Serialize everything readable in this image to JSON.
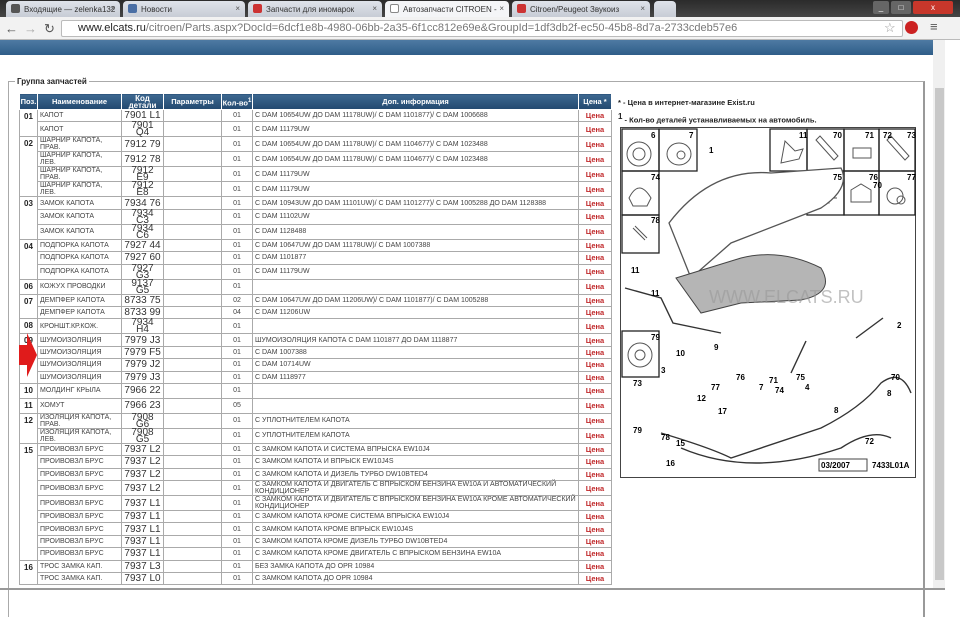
{
  "browser": {
    "tabs": [
      {
        "label": "Входящие — zelenka132",
        "active": false
      },
      {
        "label": "Новости",
        "active": false
      },
      {
        "label": "Запчасти для иномарок",
        "active": false
      },
      {
        "label": "Автозапчасти CITROEN -",
        "active": true
      },
      {
        "label": "Citroen/Peugeot Звукоиз",
        "active": false
      }
    ],
    "url_host": "www.elcats.ru",
    "url_path": "/citroen/Parts.aspx?DocId=6dcf1e8b-4980-06bb-2a35-6f1cc812e69e&GroupId=1df3db2f-ec50-45b8-8d7a-2733cdeb57e6"
  },
  "section_title": "Группа запчастей",
  "table": {
    "headers": {
      "pos": "Поз.",
      "name": "Наименование",
      "code": "Код детали",
      "params": "Параметры",
      "qty": "Кол-во",
      "qty_sup": "1",
      "info": "Доп. информация",
      "price": "Цена *"
    },
    "price_label": "Цена",
    "groups": [
      {
        "pos": "01",
        "items": [
          {
            "name": "КАПОТ",
            "code": "7901 L1",
            "qty": "01",
            "info": "С DAM 10654UW ДО DAM 11178UW)/ С DAM 1101877)/ С DAM 1006688"
          },
          {
            "name": "КАПОТ",
            "code": "7901 Q4",
            "qty": "01",
            "info": "С DAM 11179UW"
          }
        ]
      },
      {
        "pos": "02",
        "items": [
          {
            "name": "ШАРНИР КАПОТА, ПРАВ.",
            "code": "7912 79",
            "qty": "01",
            "info": "С DAM 10654UW ДО DAM 11178UW)/ С DAM 1104677)/ С DAM 1023488"
          },
          {
            "name": "ШАРНИР КАПОТА, ЛЕВ.",
            "code": "7912 78",
            "qty": "01",
            "info": "С DAM 10654UW ДО DAM 11178UW)/ С DAM 1104677)/ С DAM 1023488"
          },
          {
            "name": "ШАРНИР КАПОТА, ПРАВ.",
            "code": "7912 E9",
            "qty": "01",
            "info": "С DAM 11179UW"
          },
          {
            "name": "ШАРНИР КАПОТА, ЛЕВ.",
            "code": "7912 E8",
            "qty": "01",
            "info": "С DAM 11179UW"
          }
        ]
      },
      {
        "pos": "03",
        "items": [
          {
            "name": "ЗАМОК КАПОТА",
            "code": "7934 76",
            "qty": "01",
            "info": "С DAM 10943UW ДО DAM 11101UW)/ С DAM 1101277)/ С DAM 1005288 ДО DAM 1128388"
          },
          {
            "name": "ЗАМОК КАПОТА",
            "code": "7934 C3",
            "qty": "01",
            "info": "С DAM 11102UW"
          },
          {
            "name": "ЗАМОК КАПОТА",
            "code": "7934 C6",
            "qty": "01",
            "info": "С DAM 1128488"
          }
        ]
      },
      {
        "pos": "04",
        "items": [
          {
            "name": "ПОДПОРКА КАПОТА",
            "code": "7927 44",
            "qty": "01",
            "info": "С DAM 10647UW ДО DAM 11178UW)/ С DAM 1007388"
          },
          {
            "name": "ПОДПОРКА КАПОТА",
            "code": "7927 60",
            "qty": "01",
            "info": "С DAM 1101877"
          },
          {
            "name": "ПОДПОРКА КАПОТА",
            "code": "7927 G3",
            "qty": "01",
            "info": "С DAM 11179UW"
          }
        ]
      },
      {
        "pos": "06",
        "items": [
          {
            "name": "КОЖУХ ПРОВОДКИ",
            "code": "9137 G5",
            "qty": "01",
            "info": ""
          }
        ]
      },
      {
        "pos": "07",
        "items": [
          {
            "name": "ДЕМПФЕР КАПОТА",
            "code": "8733 75",
            "qty": "02",
            "info": "С DAM 10647UW ДО DAM 11206UW)/ С DAM 1101877)/ С DAM 1005288"
          },
          {
            "name": "ДЕМПФЕР КАПОТА",
            "code": "8733 99",
            "qty": "04",
            "info": "С DAM 11206UW"
          }
        ]
      },
      {
        "pos": "08",
        "items": [
          {
            "name": "КРОНШТ.КР.КОЖ.",
            "code": "7934 H4",
            "qty": "01",
            "info": ""
          }
        ]
      },
      {
        "pos": "09",
        "items": [
          {
            "name": "ШУМОИЗОЛЯЦИЯ",
            "code": "7979 J3",
            "qty": "01",
            "info": "ШУМОИЗОЛЯЦИЯ КАПОТА С DAM 1101877 ДО DAM 1118877"
          },
          {
            "name": "ШУМОИЗОЛЯЦИЯ",
            "code": "7979 F5",
            "qty": "01",
            "info": "С DAM 1007388"
          },
          {
            "name": "ШУМОИЗОЛЯЦИЯ",
            "code": "7979 J2",
            "qty": "01",
            "info": "С DAM 10714UW"
          },
          {
            "name": "ШУМОИЗОЛЯЦИЯ",
            "code": "7979 J3",
            "qty": "01",
            "info": "С DAM 1118977"
          }
        ]
      },
      {
        "pos": "10",
        "items": [
          {
            "name": "МОЛДИНГ КРЫЛА",
            "code": "7966 22",
            "qty": "01",
            "info": ""
          }
        ]
      },
      {
        "pos": "11",
        "items": [
          {
            "name": "ХОМУТ",
            "code": "7966 23",
            "qty": "05",
            "info": ""
          }
        ]
      },
      {
        "pos": "12",
        "items": [
          {
            "name": "ИЗОЛЯЦИЯ КАПОТА, ПРАВ.",
            "code": "7908 G6",
            "qty": "01",
            "info": "С УПЛОТНИТЕЛЕМ КАПОТА"
          },
          {
            "name": "ИЗОЛЯЦИЯ КАПОТА, ЛЕВ.",
            "code": "7908 G5",
            "qty": "01",
            "info": "С УПЛОТНИТЕЛЕМ КАПОТА"
          }
        ]
      },
      {
        "pos": "15",
        "items": [
          {
            "name": "ПРОИВОВЗЛ БРУС",
            "code": "7937 L2",
            "qty": "01",
            "info": "С ЗАМКОМ КАПОТА И СИСТЕМА ВПРЫСКА EW10J4"
          },
          {
            "name": "ПРОИВОВЗЛ БРУС",
            "code": "7937 L2",
            "qty": "01",
            "info": "С ЗАМКОМ КАПОТА И ВПРЫСК EW10J4S"
          },
          {
            "name": "ПРОИВОВЗЛ БРУС",
            "code": "7937 L2",
            "qty": "01",
            "info": "С ЗАМКОМ КАПОТА И ДИЗЕЛЬ ТУРБО DW10BTED4"
          },
          {
            "name": "ПРОИВОВЗЛ БРУС",
            "code": "7937 L2",
            "qty": "01",
            "info": "С ЗАМКОМ КАПОТА И ДВИГАТЕЛЬ С ВПРЫСКОМ БЕНЗИНА EW10A И АВТОМАТИЧЕСКИЙ КОНДИЦИОНЕР"
          },
          {
            "name": "ПРОИВОВЗЛ БРУС",
            "code": "7937 L1",
            "qty": "01",
            "info": "С ЗАМКОМ КАПОТА И ДВИГАТЕЛЬ С ВПРЫСКОМ БЕНЗИНА EW10A КРОМЕ АВТОМАТИЧЕСКИЙ КОНДИЦИОНЕР"
          },
          {
            "name": "ПРОИВОВЗЛ БРУС",
            "code": "7937 L1",
            "qty": "01",
            "info": "С ЗАМКОМ КАПОТА КРОМЕ СИСТЕМА ВПРЫСКА EW10J4"
          },
          {
            "name": "ПРОИВОВЗЛ БРУС",
            "code": "7937 L1",
            "qty": "01",
            "info": "С ЗАМКОМ КАПОТА КРОМЕ ВПРЫСК EW10J4S"
          },
          {
            "name": "ПРОИВОВЗЛ БРУС",
            "code": "7937 L1",
            "qty": "01",
            "info": "С ЗАМКОМ КАПОТА КРОМЕ ДИЗЕЛЬ ТУРБО DW10BTED4"
          },
          {
            "name": "ПРОИВОВЗЛ БРУС",
            "code": "7937 L1",
            "qty": "01",
            "info": "С ЗАМКОМ КАПОТА КРОМЕ ДВИГАТЕЛЬ С ВПРЫСКОМ БЕНЗИНА EW10A"
          }
        ]
      },
      {
        "pos": "16",
        "items": [
          {
            "name": "ТРОС ЗАМКА КАП.",
            "code": "7937 L3",
            "qty": "01",
            "info": "БЕЗ ЗАМКА КАПОТА ДО OPR 10984"
          },
          {
            "name": "ТРОС ЗАМКА КАП.",
            "code": "7937 L0",
            "qty": "01",
            "info": "С ЗАМКОМ КАПОТА ДО OPR 10984"
          }
        ]
      }
    ]
  },
  "notes": {
    "star": "*",
    "star_text": " - Цена в интернет-магазине Exist.ru",
    "one": "1",
    "one_text": " - Кол-во деталей устанавливаемых на автомобиль."
  },
  "diagram": {
    "watermark": "WWW.ELCATS.RU",
    "date": "03/2007",
    "ref": "7433L01A",
    "inset_labels": [
      "6",
      "7",
      "74",
      "78",
      "11",
      "70",
      "71",
      "72",
      "73",
      "75",
      "76",
      "77",
      "79"
    ],
    "callouts": [
      "1",
      "11",
      "11",
      "10",
      "9",
      "77",
      "76",
      "7",
      "71",
      "75",
      "4",
      "70",
      "70",
      "2",
      "3",
      "73",
      "12",
      "74",
      "17",
      "79",
      "78",
      "15",
      "16",
      "8",
      "8",
      "72"
    ]
  },
  "colors": {
    "header": "#2f5d88",
    "price": "#c0282a"
  }
}
